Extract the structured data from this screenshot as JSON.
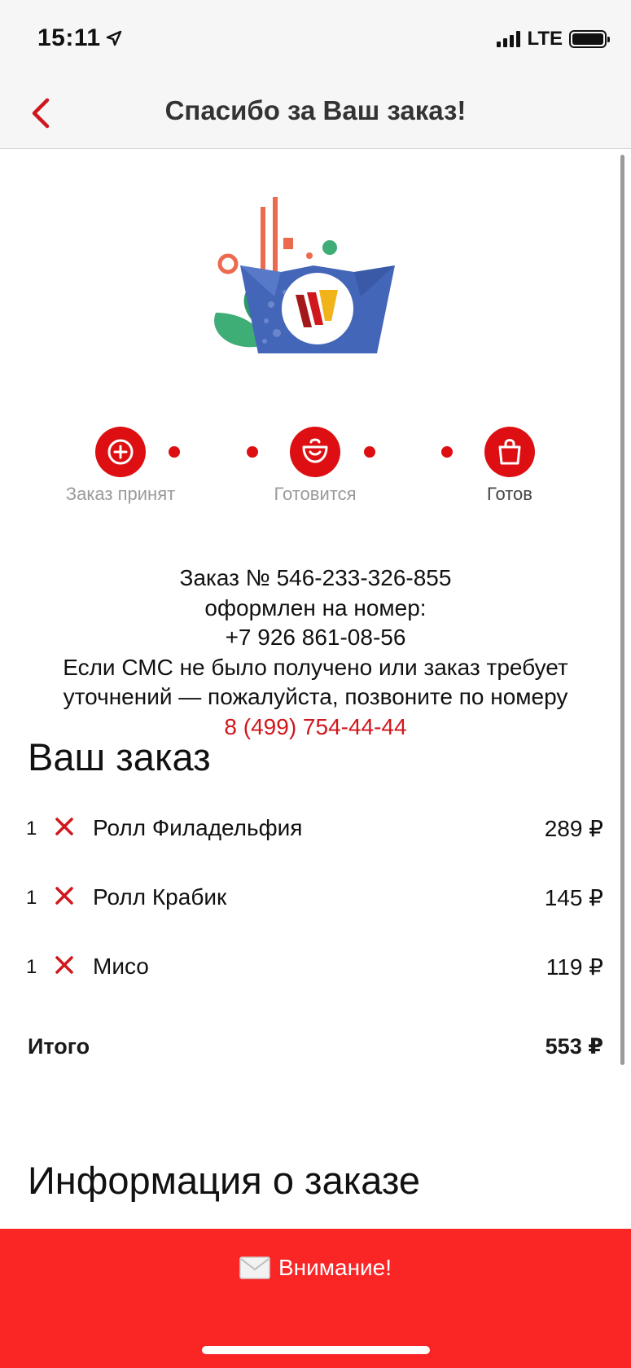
{
  "status_bar": {
    "time": "15:11",
    "network": "LTE"
  },
  "nav": {
    "title": "Спасибо за Ваш заказ!"
  },
  "progress": {
    "steps": [
      {
        "label": "Заказ принят",
        "icon": "plus-circle-icon"
      },
      {
        "label": "Готовится",
        "icon": "bowl-icon"
      },
      {
        "label": "Готов",
        "icon": "shopping-bag-icon"
      }
    ]
  },
  "order_info": {
    "line1": "Заказ № 546-233-326-855",
    "line2": "оформлен на номер:",
    "line3": "+7 926 861-08-56",
    "line4": "Если СМС не было получено или заказ требует",
    "line5": "уточнений — пожалуйста, позвоните по номеру",
    "support_phone": "8 (499) 754-44-44"
  },
  "your_order": {
    "title": "Ваш заказ",
    "items": [
      {
        "qty": "1",
        "name": "Ролл Филадельфия",
        "price": "289 ₽"
      },
      {
        "qty": "1",
        "name": "Ролл Крабик",
        "price": "145 ₽"
      },
      {
        "qty": "1",
        "name": "Мисо",
        "price": "119 ₽"
      }
    ],
    "total_label": "Итого",
    "total_value": "553 ₽"
  },
  "info_section": {
    "title": "Информация о заказе"
  },
  "alert": {
    "icon": "envelope-icon",
    "label": "Внимание!"
  },
  "colors": {
    "accent": "#dd0f12",
    "banner": "#fa2525",
    "muted": "#9a9a9a"
  }
}
